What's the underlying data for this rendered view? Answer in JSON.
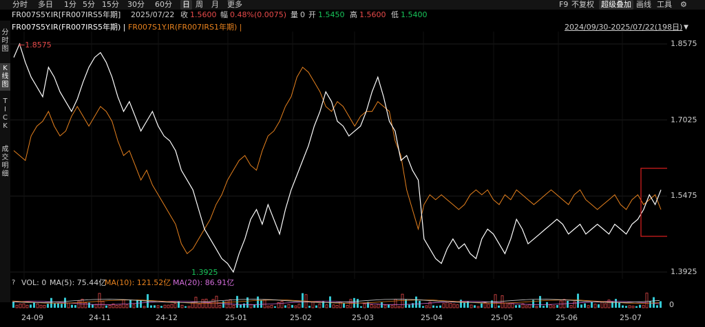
{
  "toolbar": {
    "periods": [
      "分时",
      "多日",
      "1分",
      "5分",
      "15分",
      "30分",
      "60分",
      "日",
      "周",
      "月",
      "更多"
    ],
    "active_period": "日",
    "right": [
      "F9",
      "不复权",
      "超级叠加",
      "画线",
      "工具"
    ]
  },
  "info": {
    "symbol": "FR007S5Y.IR[FR007IRS5年期]",
    "date": "2025/07/22",
    "close_label": "收",
    "close_value": "1.5600",
    "change_label": "幅",
    "change_value": "0.48%(0.0075)",
    "volume_label": "量",
    "volume_value": "0",
    "open_label": "开",
    "open_value": "1.5450",
    "high_label": "高",
    "high_value": "1.5600",
    "low_label": "低",
    "low_value": "1.5400"
  },
  "sidebar": {
    "items": [
      "分\n时\n图",
      "K\n线\n图",
      "T\nI\nC\nK",
      "成\n交\n明\n细"
    ],
    "active_index": 1
  },
  "legend": {
    "series1": "FR007S5Y.IR(FR007IRS5年期) |",
    "series2": "FR007S1Y.IR(FR007IRS1年期) |",
    "range": "2024/09/30-2025/07/22(198日)"
  },
  "volume_legend": {
    "q": "?",
    "vol": "VOL: 0",
    "ma5": "MA(5): 75.44亿",
    "ma10": "MA(10): 121.52亿",
    "ma20": "MA(20): 86.91亿",
    "zero": "0"
  },
  "colors": {
    "white_series": "#ffffff",
    "orange_series": "#e8821e",
    "up": "#e84a4a",
    "down": "#18c45a",
    "teal": "#35c9d4",
    "highlight_box": "#e02020"
  },
  "chart_data": {
    "type": "line",
    "y_ticks": [
      "1.8575",
      "1.7025",
      "1.5475",
      "1.3925"
    ],
    "ylim": [
      1.3925,
      1.8575
    ],
    "x_ticks": [
      "24-09",
      "24-11",
      "24-12",
      "25-01",
      "25-02",
      "25-03",
      "25-04",
      "25-05",
      "25-06",
      "25-07"
    ],
    "max_label": "1.8575",
    "min_label": "1.3925",
    "series": [
      {
        "name": "FR007S5Y.IR(FR007IRS5年期)",
        "values": [
          1.83,
          1.8575,
          1.82,
          1.79,
          1.77,
          1.75,
          1.81,
          1.79,
          1.76,
          1.74,
          1.72,
          1.745,
          1.78,
          1.81,
          1.83,
          1.84,
          1.82,
          1.79,
          1.75,
          1.72,
          1.74,
          1.71,
          1.68,
          1.7,
          1.72,
          1.69,
          1.67,
          1.66,
          1.64,
          1.6,
          1.58,
          1.56,
          1.52,
          1.48,
          1.46,
          1.44,
          1.42,
          1.41,
          1.3925,
          1.43,
          1.46,
          1.5,
          1.52,
          1.49,
          1.53,
          1.5,
          1.47,
          1.52,
          1.56,
          1.59,
          1.62,
          1.65,
          1.69,
          1.72,
          1.76,
          1.74,
          1.7,
          1.69,
          1.67,
          1.68,
          1.69,
          1.72,
          1.76,
          1.79,
          1.75,
          1.7,
          1.68,
          1.62,
          1.63,
          1.6,
          1.58,
          1.46,
          1.44,
          1.42,
          1.41,
          1.44,
          1.46,
          1.44,
          1.45,
          1.43,
          1.42,
          1.46,
          1.48,
          1.47,
          1.45,
          1.43,
          1.46,
          1.5,
          1.48,
          1.45,
          1.46,
          1.47,
          1.48,
          1.49,
          1.5,
          1.49,
          1.47,
          1.48,
          1.49,
          1.47,
          1.48,
          1.49,
          1.48,
          1.47,
          1.49,
          1.48,
          1.47,
          1.49,
          1.5,
          1.52,
          1.55,
          1.53,
          1.56
        ]
      },
      {
        "name": "FR007S1Y.IR(FR007IRS1年期)",
        "values": [
          1.64,
          1.63,
          1.62,
          1.67,
          1.69,
          1.7,
          1.72,
          1.69,
          1.67,
          1.68,
          1.71,
          1.73,
          1.71,
          1.69,
          1.71,
          1.73,
          1.72,
          1.7,
          1.66,
          1.63,
          1.64,
          1.61,
          1.58,
          1.6,
          1.57,
          1.55,
          1.53,
          1.51,
          1.49,
          1.45,
          1.43,
          1.44,
          1.46,
          1.48,
          1.5,
          1.53,
          1.55,
          1.58,
          1.6,
          1.62,
          1.63,
          1.61,
          1.6,
          1.64,
          1.67,
          1.68,
          1.7,
          1.73,
          1.75,
          1.79,
          1.81,
          1.8,
          1.78,
          1.76,
          1.73,
          1.72,
          1.74,
          1.73,
          1.71,
          1.69,
          1.71,
          1.72,
          1.72,
          1.74,
          1.73,
          1.72,
          1.66,
          1.63,
          1.56,
          1.52,
          1.48,
          1.53,
          1.55,
          1.54,
          1.55,
          1.54,
          1.53,
          1.52,
          1.53,
          1.55,
          1.56,
          1.55,
          1.56,
          1.54,
          1.53,
          1.55,
          1.54,
          1.56,
          1.55,
          1.54,
          1.53,
          1.54,
          1.55,
          1.56,
          1.55,
          1.54,
          1.53,
          1.55,
          1.56,
          1.54,
          1.53,
          1.52,
          1.53,
          1.54,
          1.55,
          1.53,
          1.52,
          1.54,
          1.55,
          1.53,
          1.54,
          1.55,
          1.52
        ]
      }
    ]
  }
}
